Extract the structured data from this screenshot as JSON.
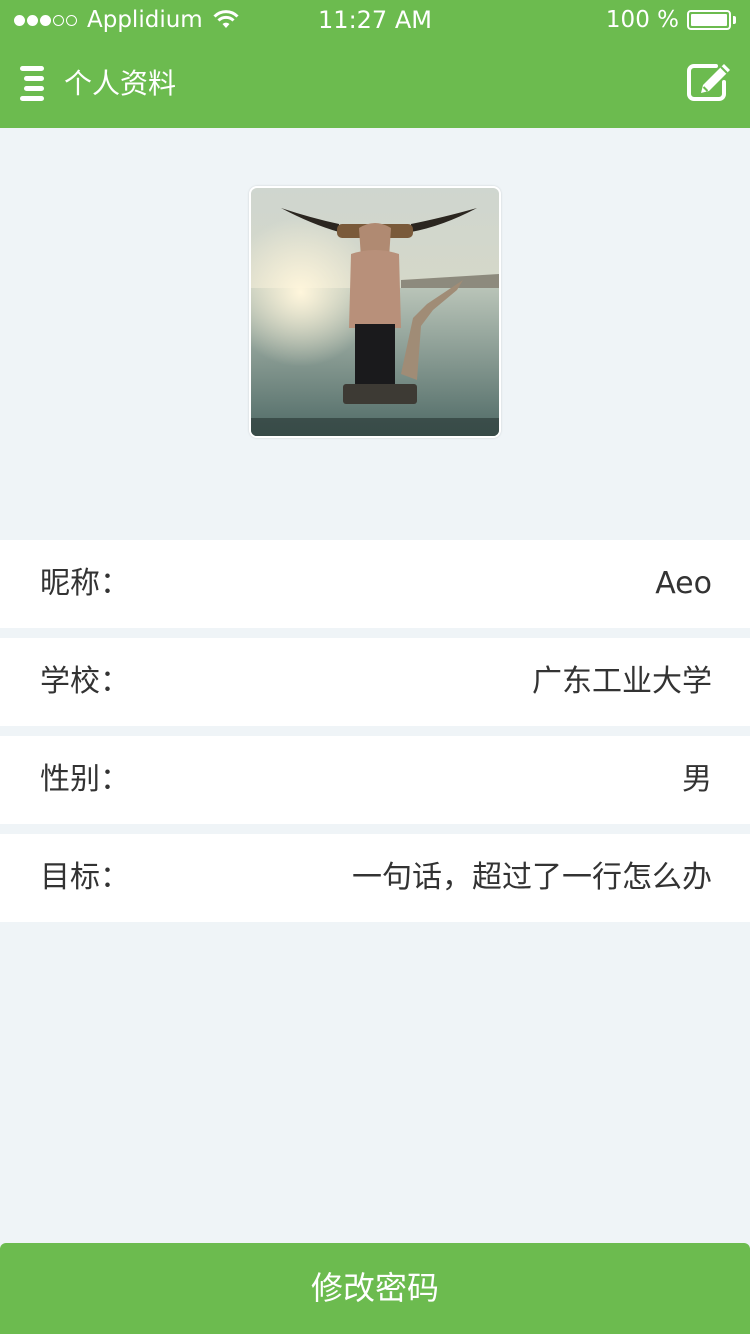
{
  "status_bar": {
    "carrier": "Applidium",
    "time": "11:27 AM",
    "battery_percent": "100 %",
    "signal_bars_filled": 3,
    "signal_bars_total": 5
  },
  "nav": {
    "title": "个人资料",
    "left_icon": "menu-icon",
    "right_icon": "edit-icon"
  },
  "avatar": {
    "icon": "avatar-photo"
  },
  "profile": {
    "rows": [
      {
        "label": "昵称：",
        "value": "Aeo"
      },
      {
        "label": "学校：",
        "value": "广东工业大学"
      },
      {
        "label": "性别：",
        "value": "男"
      },
      {
        "label": "目标：",
        "value": "一句话，超过了一行怎么办"
      }
    ]
  },
  "actions": {
    "change_password": "修改密码"
  },
  "colors": {
    "brand_green": "#6cbb4f",
    "page_background": "#eff4f7",
    "row_background": "#ffffff",
    "text": "#333333"
  }
}
